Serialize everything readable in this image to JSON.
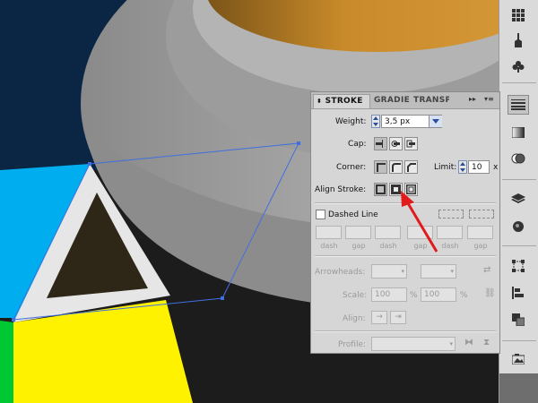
{
  "panel": {
    "tabs": [
      {
        "label": "STROKE",
        "active": true
      },
      {
        "label": "GRADIENT",
        "active": false
      },
      {
        "label": "TRANSPARENCY",
        "active": false
      }
    ],
    "weight": {
      "label": "Weight:",
      "value": "3,5 px"
    },
    "cap": {
      "label": "Cap:"
    },
    "corner": {
      "label": "Corner:"
    },
    "limit": {
      "label": "Limit:",
      "value": "10",
      "unit": "x"
    },
    "align_stroke": {
      "label": "Align Stroke:"
    },
    "dashed_line": {
      "label": "Dashed Line",
      "checked": false
    },
    "dash_labels": [
      "dash",
      "gap",
      "dash",
      "gap",
      "dash",
      "gap"
    ],
    "arrowheads": {
      "label": "Arrowheads:"
    },
    "scale": {
      "label": "Scale:",
      "start": "100",
      "end": "100",
      "unit": "%"
    },
    "align": {
      "label": "Align:"
    },
    "profile": {
      "label": "Profile:"
    }
  },
  "colors": {
    "background_navy": "#0b2645",
    "cyan": "#00aeef",
    "yellow": "#fff200",
    "green": "#00c832",
    "dark_brown": "#2e2717",
    "grey_ring": "#a0a0a0",
    "gold": "#c88a2a",
    "selection": "#3f6fe0",
    "arrow": "#e11b1b"
  },
  "dock": {
    "icons": [
      "swatches-grid-icon",
      "brush-icon",
      "club-symbol-icon",
      "stroke-lines-icon",
      "gradient-icon",
      "transparency-icon",
      "layers-icon",
      "appearance-icon",
      "transform-icon",
      "align-icon",
      "pathfinder-icon",
      "image-icon"
    ]
  }
}
